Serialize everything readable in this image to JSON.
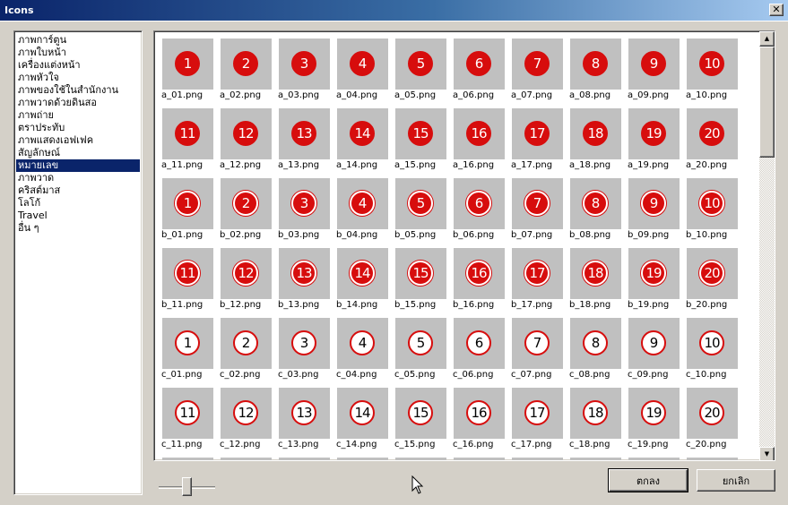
{
  "window": {
    "title": "Icons",
    "close_glyph": "✕"
  },
  "categories": {
    "selected_index": 10,
    "items": [
      "ภาพการ์ตูน",
      "ภาพใบหน้า",
      "เครื่องแต่งหน้า",
      "ภาพหัวใจ",
      "ภาพของใช้ในสำนักงาน",
      "ภาพวาดด้วยดินสอ",
      "ภาพถ่าย",
      "ตราประทับ",
      "ภาพแสดงเอฟเฟค",
      "สัญลักษณ์",
      "หมายเลข",
      "ภาพวาด",
      "คริสต์มาส",
      "โลโก้",
      "Travel",
      "อื่น ๆ"
    ]
  },
  "icons": {
    "rows": [
      {
        "style": "red",
        "items": [
          {
            "num": "1",
            "file": "a_01.png"
          },
          {
            "num": "2",
            "file": "a_02.png"
          },
          {
            "num": "3",
            "file": "a_03.png"
          },
          {
            "num": "4",
            "file": "a_04.png"
          },
          {
            "num": "5",
            "file": "a_05.png"
          },
          {
            "num": "6",
            "file": "a_06.png"
          },
          {
            "num": "7",
            "file": "a_07.png"
          },
          {
            "num": "8",
            "file": "a_08.png"
          },
          {
            "num": "9",
            "file": "a_09.png"
          },
          {
            "num": "10",
            "file": "a_10.png"
          }
        ]
      },
      {
        "style": "red",
        "items": [
          {
            "num": "11",
            "file": "a_11.png"
          },
          {
            "num": "12",
            "file": "a_12.png"
          },
          {
            "num": "13",
            "file": "a_13.png"
          },
          {
            "num": "14",
            "file": "a_14.png"
          },
          {
            "num": "15",
            "file": "a_15.png"
          },
          {
            "num": "16",
            "file": "a_16.png"
          },
          {
            "num": "17",
            "file": "a_17.png"
          },
          {
            "num": "18",
            "file": "a_18.png"
          },
          {
            "num": "19",
            "file": "a_19.png"
          },
          {
            "num": "20",
            "file": "a_20.png"
          }
        ]
      },
      {
        "style": "red-outlined",
        "items": [
          {
            "num": "1",
            "file": "b_01.png"
          },
          {
            "num": "2",
            "file": "b_02.png"
          },
          {
            "num": "3",
            "file": "b_03.png"
          },
          {
            "num": "4",
            "file": "b_04.png"
          },
          {
            "num": "5",
            "file": "b_05.png"
          },
          {
            "num": "6",
            "file": "b_06.png"
          },
          {
            "num": "7",
            "file": "b_07.png"
          },
          {
            "num": "8",
            "file": "b_08.png"
          },
          {
            "num": "9",
            "file": "b_09.png"
          },
          {
            "num": "10",
            "file": "b_10.png"
          }
        ]
      },
      {
        "style": "red-outlined",
        "items": [
          {
            "num": "11",
            "file": "b_11.png"
          },
          {
            "num": "12",
            "file": "b_12.png"
          },
          {
            "num": "13",
            "file": "b_13.png"
          },
          {
            "num": "14",
            "file": "b_14.png"
          },
          {
            "num": "15",
            "file": "b_15.png"
          },
          {
            "num": "16",
            "file": "b_16.png"
          },
          {
            "num": "17",
            "file": "b_17.png"
          },
          {
            "num": "18",
            "file": "b_18.png"
          },
          {
            "num": "19",
            "file": "b_19.png"
          },
          {
            "num": "20",
            "file": "b_20.png"
          }
        ]
      },
      {
        "style": "white",
        "items": [
          {
            "num": "1",
            "file": "c_01.png"
          },
          {
            "num": "2",
            "file": "c_02.png"
          },
          {
            "num": "3",
            "file": "c_03.png"
          },
          {
            "num": "4",
            "file": "c_04.png"
          },
          {
            "num": "5",
            "file": "c_05.png"
          },
          {
            "num": "6",
            "file": "c_06.png"
          },
          {
            "num": "7",
            "file": "c_07.png"
          },
          {
            "num": "8",
            "file": "c_08.png"
          },
          {
            "num": "9",
            "file": "c_09.png"
          },
          {
            "num": "10",
            "file": "c_10.png"
          }
        ]
      },
      {
        "style": "white",
        "items": [
          {
            "num": "11",
            "file": "c_11.png"
          },
          {
            "num": "12",
            "file": "c_12.png"
          },
          {
            "num": "13",
            "file": "c_13.png"
          },
          {
            "num": "14",
            "file": "c_14.png"
          },
          {
            "num": "15",
            "file": "c_15.png"
          },
          {
            "num": "16",
            "file": "c_16.png"
          },
          {
            "num": "17",
            "file": "c_17.png"
          },
          {
            "num": "18",
            "file": "c_18.png"
          },
          {
            "num": "19",
            "file": "c_19.png"
          },
          {
            "num": "20",
            "file": "c_20.png"
          }
        ]
      }
    ],
    "colors": {
      "red": "#d70d0d",
      "thumb_bg": "#c0c0c0"
    }
  },
  "scrollbar": {
    "up_glyph": "▲",
    "down_glyph": "▼"
  },
  "buttons": {
    "ok_label": "ตกลง",
    "cancel_label": "ยกเลิก"
  },
  "colors": {
    "selection": "#0a246a",
    "dialog_bg": "#d4d0c8"
  }
}
